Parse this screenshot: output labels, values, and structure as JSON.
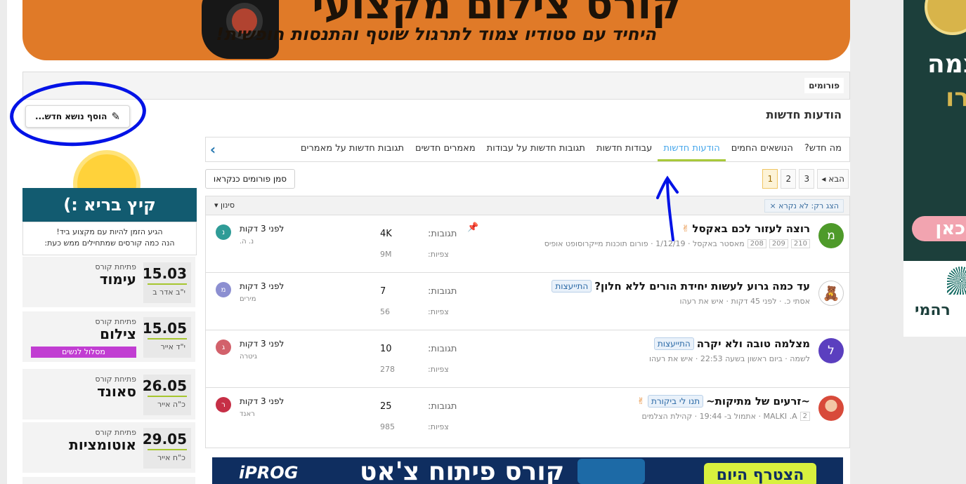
{
  "banner_top": {
    "title": "קורס צילום מקצועי",
    "subtitle": "היחיד עם סטודיו צמוד לתרגול שוטף והתנסות חופשית!"
  },
  "breadcrumb": {
    "item": "פורומים"
  },
  "page_title": "הודעות חדשות",
  "add_topic": {
    "label": "הוסף נושא חדש..."
  },
  "tabs": [
    {
      "label": "מה חדש?"
    },
    {
      "label": "הנושאים החמים"
    },
    {
      "label": "הודעות חדשות"
    },
    {
      "label": "עבודות חדשות"
    },
    {
      "label": "תגובות חדשות על עבודות"
    },
    {
      "label": "מאמרים חדשים"
    },
    {
      "label": "תגובות חדשות על מאמרים"
    }
  ],
  "pager": {
    "pages": [
      "1",
      "2",
      "3"
    ],
    "current": "1",
    "next_label": "הבא ◂"
  },
  "mark_read": {
    "label": "סמן פורומים כנקראו"
  },
  "filter": {
    "chip": "הצג רק: לא נקרא ×",
    "menu": "סינון ▾"
  },
  "threads": [
    {
      "avatar_letter": "מ",
      "avatar_color": "#4e9a2a",
      "prefix": "",
      "title": "רוצה לעזור לכם באקסל",
      "meta": "מאסטר באקסל · 1/12/19 · פורום תוכנות מייקרוסופט אופיס",
      "pages": [
        "208",
        "209",
        "210"
      ],
      "replies_label": "תגובות:",
      "replies": "4K",
      "views_label": "צפיות:",
      "views": "9M",
      "last_time": "לפני 3 דקות",
      "last_user": "נ. ה.",
      "last_letter": "נ",
      "last_color": "#2f9c97"
    },
    {
      "avatar_letter": "",
      "avatar_color": "#ffffff",
      "prefix": "התייעצות",
      "title": "עד כמה גרוע לעשות יחידת הורים ללא חלון?",
      "meta": "אסתי כ. · לפני 45 דקות · איש את רעהו",
      "pages": [],
      "replies_label": "תגובות:",
      "replies": "7",
      "views_label": "צפיות:",
      "views": "56",
      "last_time": "לפני 3 דקות",
      "last_user": "מירים",
      "last_letter": "מ",
      "last_color": "#8c8fd1"
    },
    {
      "avatar_letter": "ל",
      "avatar_color": "#5b3fbf",
      "prefix": "התייעצות",
      "title": "מצלמה טובה ולא יקרה",
      "meta": "לשמה · ביום ראשון בשעה 22:53 · איש את רעהו",
      "pages": [],
      "replies_label": "תגובות:",
      "replies": "10",
      "views_label": "צפיות:",
      "views": "278",
      "last_time": "לפני 3 דקות",
      "last_user": "גיטרה",
      "last_letter": "ג",
      "last_color": "#d2616b"
    },
    {
      "avatar_letter": "",
      "avatar_color": "#d84a3a",
      "prefix": "תנו לי ביקורת",
      "title": "~זרעים של מתיקות~",
      "meta": "MALKI .A · אתמול ב- 19:44 · קהילת הצלמים",
      "pages": [
        "2"
      ],
      "replies_label": "תגובות:",
      "replies": "25",
      "views_label": "צפיות:",
      "views": "985",
      "last_time": "לפני 3 דקות",
      "last_user": "ראנד",
      "last_letter": "ר",
      "last_color": "#c62f46"
    }
  ],
  "bottom_banner": {
    "brand": "iPROG",
    "title": "קורס פיתוח צ'אט",
    "cta": "הצטרף היום"
  },
  "sidebar": {
    "summer_title": "קיץ בריא :)",
    "intro_line1": "הגיע הזמן להיות עם מקצוע ביד!",
    "intro_line2": "הנה כמה קורסים שמתחילים ממש כעת:",
    "courses": [
      {
        "label": "פתיחת קורס",
        "name": "עימוד",
        "date": "15.03",
        "heb_date": "י\"ב אדר ב",
        "tag": ""
      },
      {
        "label": "פתיחת קורס",
        "name": "צילום",
        "date": "15.05",
        "heb_date": "י\"ד אייר",
        "tag": "מסלול לנשים"
      },
      {
        "label": "פתיחת קורס",
        "name": "סאונד",
        "date": "26.05",
        "heb_date": "כ\"ה אייר",
        "tag": ""
      },
      {
        "label": "פתיחת קורס",
        "name": "אוטומציות",
        "date": "29.05",
        "heb_date": "כ\"ח אייר",
        "tag": ""
      }
    ]
  },
  "side_ad": {
    "line1": "צמה",
    "line2": "רו",
    "pill": "כאן",
    "logo": "רהמי"
  }
}
